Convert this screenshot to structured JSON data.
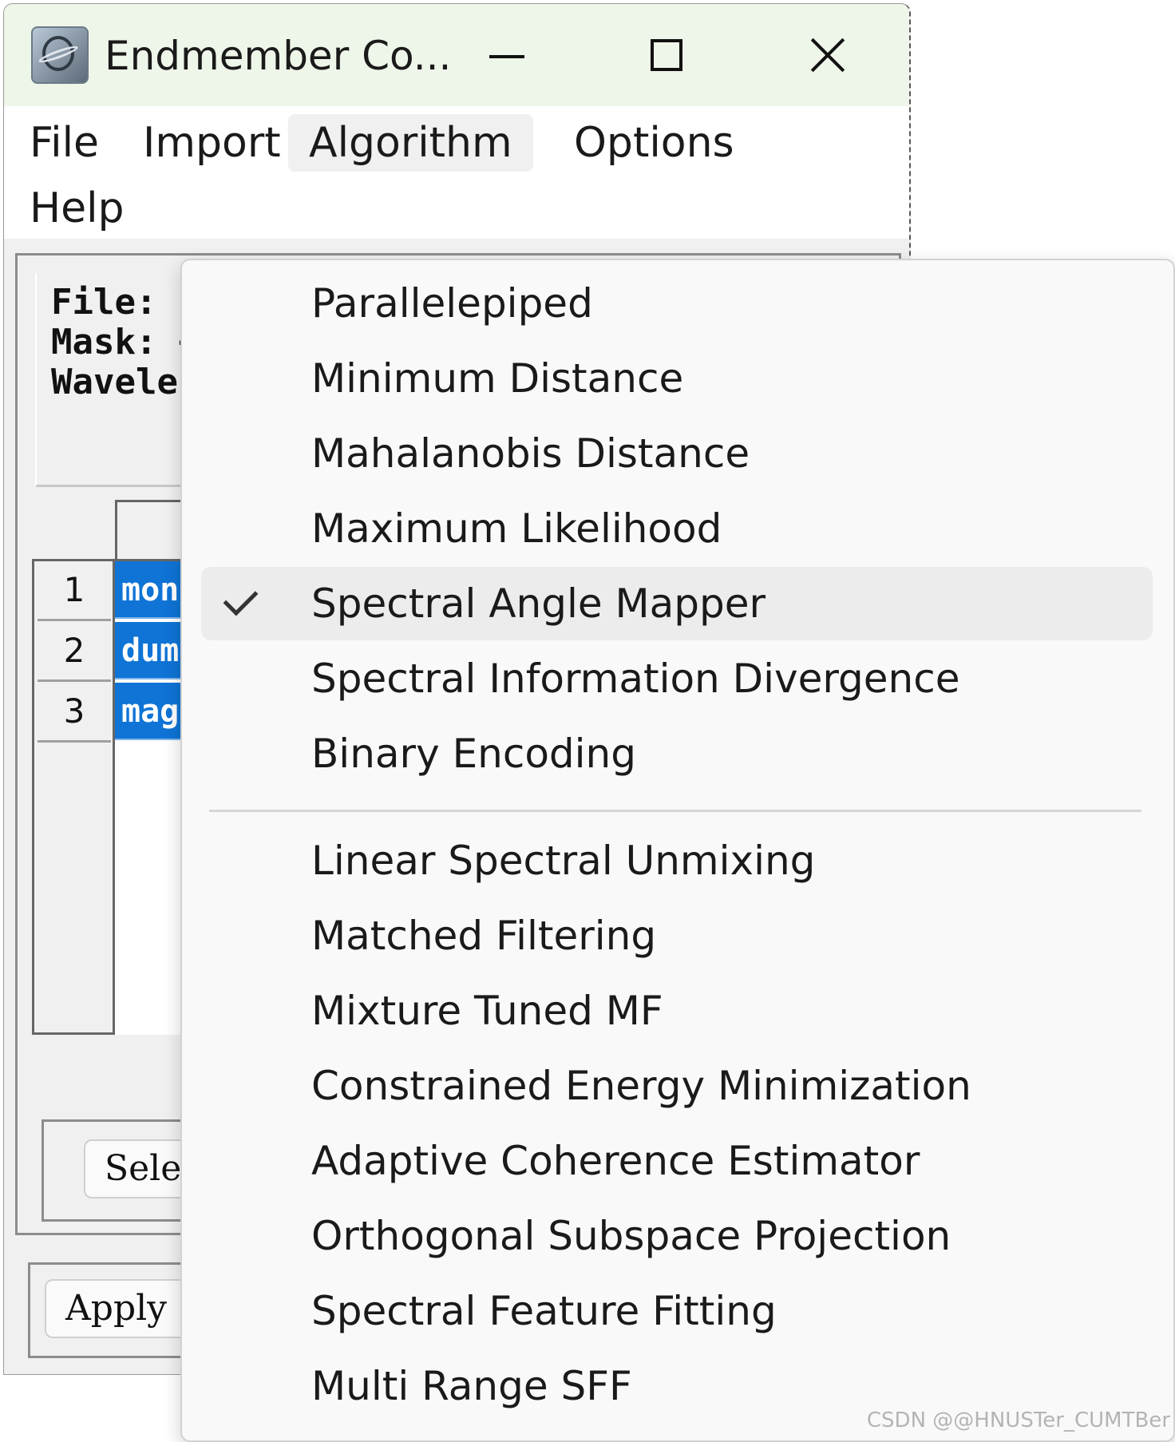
{
  "window": {
    "title": "Endmember Co...",
    "controls": {
      "minimize": "minimize",
      "maximize": "maximize",
      "close": "close"
    }
  },
  "menubar": {
    "items": [
      "File",
      "Import",
      "Algorithm",
      "Options",
      "Help"
    ],
    "active": "Algorithm"
  },
  "info": {
    "file_line": "File: C",
    "mask_line": "Mask: <",
    "wavelength_line": "Wavelen"
  },
  "table": {
    "rows": [
      {
        "num": "1",
        "name": "mon"
      },
      {
        "num": "2",
        "name": "dum"
      },
      {
        "num": "3",
        "name": "mag"
      }
    ]
  },
  "buttons": {
    "select_label": "Selec",
    "apply_label": "Apply"
  },
  "algorithm_menu": {
    "items": [
      "Parallelepiped",
      "Minimum Distance",
      "Mahalanobis Distance",
      "Maximum Likelihood",
      "Spectral Angle Mapper",
      "Spectral Information Divergence",
      "Binary Encoding",
      "Linear Spectral Unmixing",
      "Matched Filtering",
      "Mixture Tuned MF",
      "Constrained Energy Minimization",
      "Adaptive Coherence Estimator",
      "Orthogonal Subspace Projection",
      "Spectral Feature Fitting",
      "Multi Range SFF"
    ],
    "checked": "Spectral Angle Mapper"
  },
  "watermark": "CSDN @@HNUSTer_CUMTBer",
  "colors": {
    "selection_blue": "#0f74d6",
    "titlebar_bg": "#eef5e9",
    "menu_bg": "#f9f9f9"
  }
}
